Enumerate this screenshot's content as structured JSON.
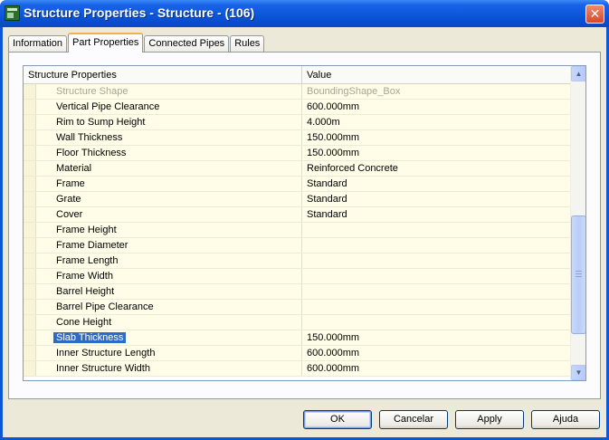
{
  "window": {
    "title": "Structure Properties - Structure - (106)",
    "close_symbol": "✕"
  },
  "tabs": [
    {
      "label": "Information",
      "active": false
    },
    {
      "label": "Part Properties",
      "active": true
    },
    {
      "label": "Connected Pipes",
      "active": false
    },
    {
      "label": "Rules",
      "active": false
    }
  ],
  "grid": {
    "headers": {
      "name": "Structure Properties",
      "value": "Value"
    },
    "rows": [
      {
        "name": "Structure Shape",
        "value": "BoundingShape_Box",
        "state": "disabled"
      },
      {
        "name": "Vertical Pipe Clearance",
        "value": "600.000mm",
        "state": ""
      },
      {
        "name": "Rim to Sump Height",
        "value": "4.000m",
        "state": ""
      },
      {
        "name": "Wall Thickness",
        "value": "150.000mm",
        "state": ""
      },
      {
        "name": "Floor Thickness",
        "value": "150.000mm",
        "state": ""
      },
      {
        "name": "Material",
        "value": "Reinforced Concrete",
        "state": ""
      },
      {
        "name": "Frame",
        "value": "Standard",
        "state": ""
      },
      {
        "name": "Grate",
        "value": "Standard",
        "state": ""
      },
      {
        "name": "Cover",
        "value": "Standard",
        "state": ""
      },
      {
        "name": "Frame Height",
        "value": "",
        "state": ""
      },
      {
        "name": "Frame Diameter",
        "value": "",
        "state": ""
      },
      {
        "name": "Frame Length",
        "value": "",
        "state": ""
      },
      {
        "name": "Frame Width",
        "value": "",
        "state": ""
      },
      {
        "name": "Barrel Height",
        "value": "",
        "state": ""
      },
      {
        "name": "Barrel Pipe Clearance",
        "value": "",
        "state": ""
      },
      {
        "name": "Cone Height",
        "value": "",
        "state": ""
      },
      {
        "name": "Slab Thickness",
        "value": "150.000mm",
        "state": "selected"
      },
      {
        "name": "Inner Structure Length",
        "value": "600.000mm",
        "state": ""
      },
      {
        "name": "Inner Structure Width",
        "value": "600.000mm",
        "state": ""
      }
    ]
  },
  "buttons": {
    "ok": "OK",
    "cancel": "Cancelar",
    "apply": "Apply",
    "help": "Ajuda"
  },
  "scrollbar": {
    "up_symbol": "▲",
    "down_symbol": "▼"
  }
}
